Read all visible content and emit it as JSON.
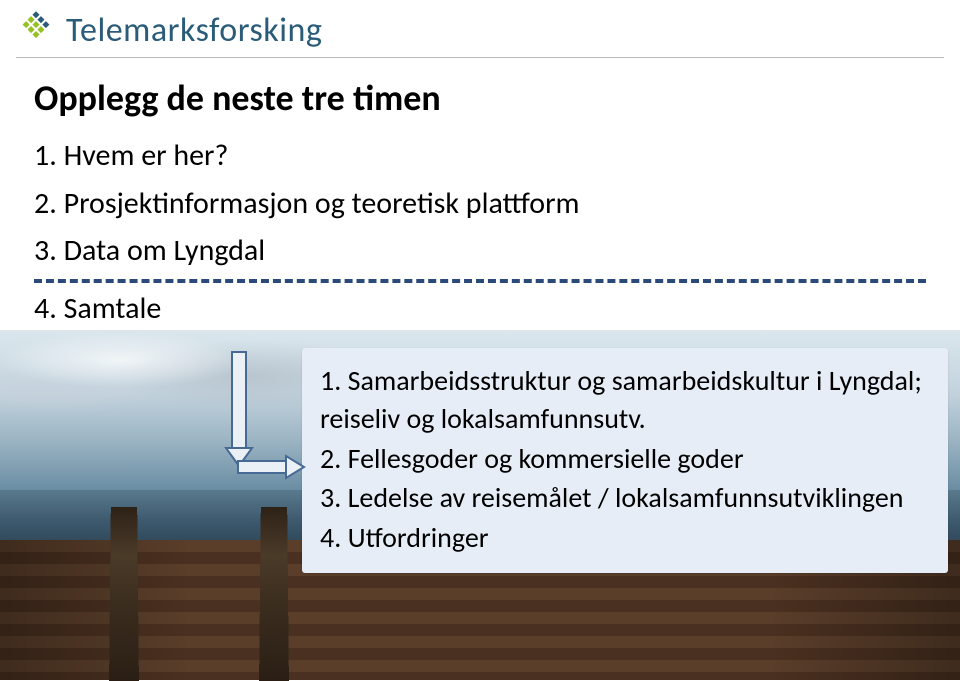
{
  "brand": {
    "name": "Telemarksforsking"
  },
  "slide": {
    "title": "Opplegg de neste tre timen",
    "outer": [
      {
        "num": "1.",
        "text": "Hvem er her?"
      },
      {
        "num": "2.",
        "text": "Prosjektinformasjon og teoretisk plattform"
      },
      {
        "num": "3.",
        "text": "Data om Lyngdal"
      },
      {
        "num": "4.",
        "text": "Samtale"
      }
    ],
    "sub": [
      {
        "num": "1.",
        "text": "Samarbeidsstruktur og samarbeidskultur i Lyngdal; reiseliv og lokalsamfunnsutv."
      },
      {
        "num": "2.",
        "text": "Fellesgoder og kommersielle goder"
      },
      {
        "num": "3.",
        "text": "Ledelse av reisemålet / lokalsamfunnsutviklingen"
      },
      {
        "num": "4.",
        "text": "Utfordringer"
      }
    ]
  }
}
